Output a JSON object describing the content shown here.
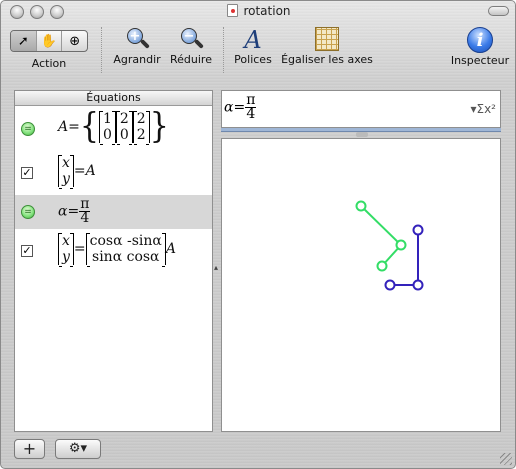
{
  "window": {
    "title": "rotation"
  },
  "toolbar": {
    "action_label": "Action",
    "zoom_in_label": "Agrandir",
    "zoom_out_label": "Réduire",
    "fonts_label": "Polices",
    "equalize_axes_label": "Égaliser les axes",
    "inspector_label": "Inspecteur",
    "tools": [
      "arrow-tool-icon",
      "hand-tool-icon",
      "zoom-tool-icon"
    ]
  },
  "equations_panel": {
    "header": "Équations",
    "rows": [
      {
        "toggle": "graph-toggle",
        "text": "A = { [1;0], [2;0], [2;2] }",
        "lhs": "A=",
        "m1": [
          "1",
          "0"
        ],
        "m2": [
          "2",
          "0"
        ],
        "m3": [
          "2",
          "2"
        ]
      },
      {
        "toggle": "checkbox",
        "checked": true,
        "m": [
          "x",
          "y"
        ],
        "rhs": "=A"
      },
      {
        "toggle": "graph-toggle",
        "selected": true,
        "lhs": "α=",
        "num": "π",
        "den": "4"
      },
      {
        "toggle": "checkbox",
        "checked": true,
        "m": [
          "x",
          "y"
        ],
        "r1": "cosα -sinα",
        "r2": "sinα cosα",
        "rhs": "A"
      }
    ]
  },
  "editor": {
    "lhs": "α=",
    "num": "π",
    "den": "4",
    "sigma_label": "▾Σx²"
  },
  "graph": {
    "series": [
      {
        "name": "",
        "color": "#33dd66",
        "points": [
          [
            360,
            205
          ],
          [
            400,
            244
          ],
          [
            381,
            265
          ]
        ]
      },
      {
        "name": "",
        "color": "#3322bb",
        "points": [
          [
            389,
            284
          ],
          [
            417,
            284
          ],
          [
            417,
            229
          ]
        ]
      }
    ]
  },
  "bottom": {
    "add_label": "+",
    "gear_label": "⚙▾"
  },
  "colors": {
    "green": "#33dd66",
    "blue": "#3322bb"
  }
}
